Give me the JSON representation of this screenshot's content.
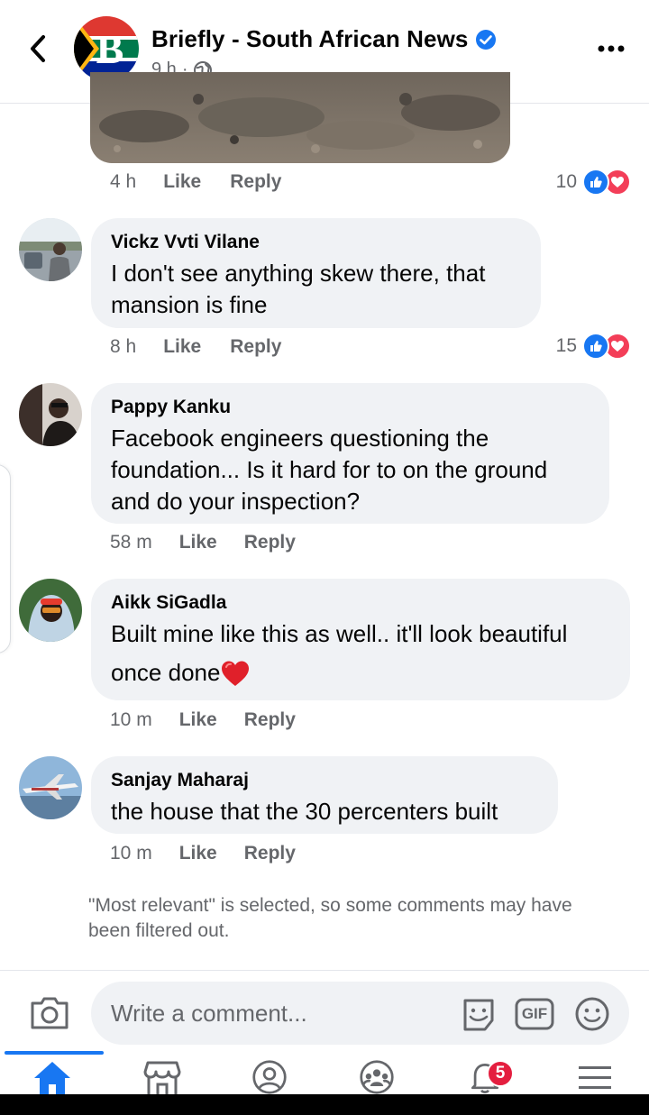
{
  "header": {
    "page_name": "Briefly - South African News",
    "time": "9 h",
    "dot": "·",
    "logo_letter": "B"
  },
  "comments": [
    {
      "author": "",
      "time": "4 h",
      "like": "Like",
      "reply": "Reply",
      "reaction_count": "10"
    },
    {
      "author": "Vickz Vvti Vilane",
      "lines": [
        "I don't see anything skew there, that",
        "mansion is fine"
      ],
      "time": "8 h",
      "like": "Like",
      "reply": "Reply",
      "reaction_count": "15"
    },
    {
      "author": "Pappy Kanku",
      "lines": [
        "Facebook engineers questioning the",
        "foundation... Is it hard for to on the ground",
        "and do your inspection?"
      ],
      "time": "58 m",
      "like": "Like",
      "reply": "Reply"
    },
    {
      "author": "Aikk SiGadla",
      "lines": [
        "Built mine like this as well.. it'll look beautiful",
        "once done"
      ],
      "time": "10 m",
      "like": "Like",
      "reply": "Reply"
    },
    {
      "author": "Sanjay Maharaj",
      "lines": [
        "the house that the 30 percenters built"
      ],
      "time": "10 m",
      "like": "Like",
      "reply": "Reply"
    }
  ],
  "filter_note": "\"Most relevant\" is selected, so some comments may have been filtered out.",
  "composer": {
    "placeholder": "Write a comment...",
    "gif_label": "GIF"
  },
  "nav": {
    "notification_badge": "5",
    "active_tab": "home"
  },
  "colors": {
    "accent": "#1877f2",
    "bubble": "#f0f2f5",
    "secondary_text": "#65676b",
    "love": "#f33e58",
    "badge": "#e41e3f"
  }
}
